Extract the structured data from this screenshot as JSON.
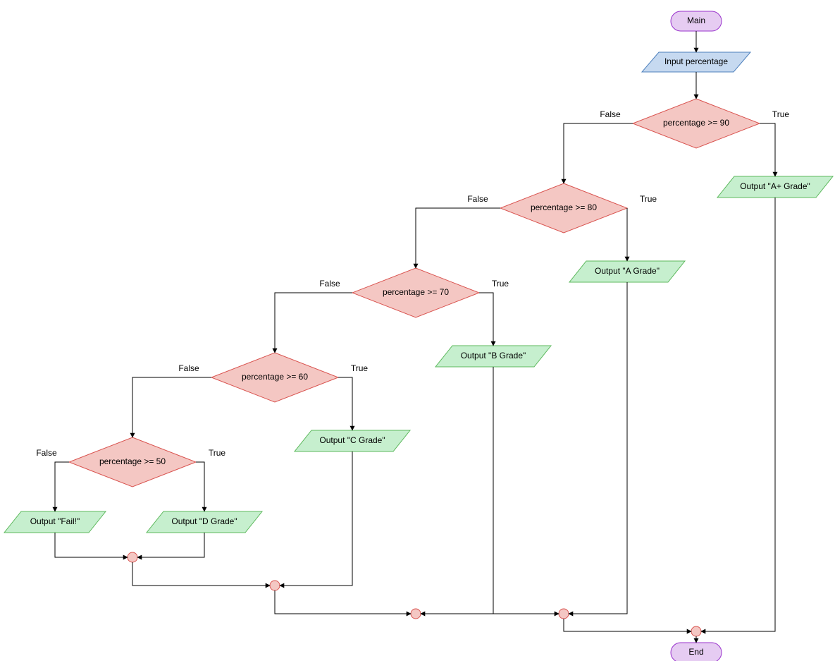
{
  "colors": {
    "terminator_fill": "#e6ccf2",
    "terminator_stroke": "#9933cc",
    "io_input_fill": "#c6d9f0",
    "io_input_stroke": "#4f81bd",
    "io_output_fill": "#c6efce",
    "io_output_stroke": "#5cb85c",
    "decision_fill": "#f4c7c3",
    "decision_stroke": "#d9534f",
    "merge_fill": "#f4c7c3",
    "merge_stroke": "#d9534f",
    "edge": "#000000"
  },
  "nodes": {
    "main": {
      "label": "Main"
    },
    "input": {
      "label": "Input percentage"
    },
    "d90": {
      "label": "percentage >= 90"
    },
    "d80": {
      "label": "percentage >= 80"
    },
    "d70": {
      "label": "percentage >= 70"
    },
    "d60": {
      "label": "percentage >= 60"
    },
    "d50": {
      "label": "percentage >= 50"
    },
    "oAplus": {
      "label": "Output \"A+ Grade\""
    },
    "oA": {
      "label": "Output \"A Grade\""
    },
    "oB": {
      "label": "Output \"B Grade\""
    },
    "oC": {
      "label": "Output \"C Grade\""
    },
    "oD": {
      "label": "Output \"D Grade\""
    },
    "oFail": {
      "label": "Output \"Fail!\""
    },
    "end": {
      "label": "End"
    }
  },
  "edgeLabels": {
    "true": "True",
    "false": "False"
  }
}
